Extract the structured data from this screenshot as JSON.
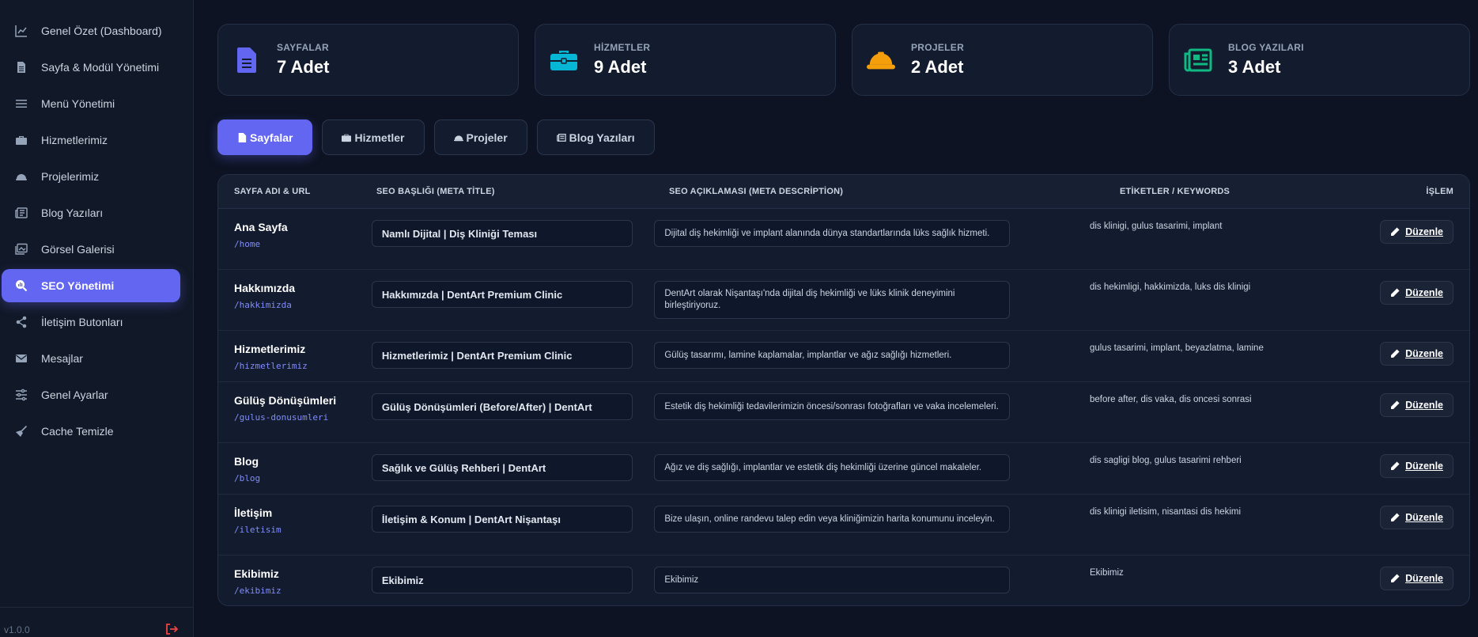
{
  "sidebar": {
    "items": [
      {
        "label": "Genel Özet (Dashboard)",
        "icon": "chart-line-icon"
      },
      {
        "label": "Sayfa & Modül Yönetimi",
        "icon": "file-icon"
      },
      {
        "label": "Menü Yönetimi",
        "icon": "bars-icon"
      },
      {
        "label": "Hizmetlerimiz",
        "icon": "briefcase-icon"
      },
      {
        "label": "Projelerimiz",
        "icon": "hardhat-icon"
      },
      {
        "label": "Blog Yazıları",
        "icon": "newspaper-icon"
      },
      {
        "label": "Görsel Galerisi",
        "icon": "images-icon"
      },
      {
        "label": "SEO Yönetimi",
        "icon": "search-chart-icon",
        "active": true
      },
      {
        "label": "İletişim Butonları",
        "icon": "share-icon"
      },
      {
        "label": "Mesajlar",
        "icon": "envelope-icon"
      },
      {
        "label": "Genel Ayarlar",
        "icon": "sliders-icon"
      },
      {
        "label": "Cache Temizle",
        "icon": "broom-icon"
      }
    ],
    "version": "v1.0.0"
  },
  "stats": [
    {
      "label": "SAYFALAR",
      "value": "7 Adet",
      "icon": "file-icon",
      "color": "#6366f1"
    },
    {
      "label": "HİZMETLER",
      "value": "9 Adet",
      "icon": "briefcase-icon",
      "color": "#06b6d4"
    },
    {
      "label": "PROJELER",
      "value": "2 Adet",
      "icon": "hardhat-icon",
      "color": "#f59e0b"
    },
    {
      "label": "BLOG YAZILARI",
      "value": "3 Adet",
      "icon": "newspaper-icon",
      "color": "#10b981"
    }
  ],
  "tabs": [
    {
      "label": "Sayfalar",
      "active": true
    },
    {
      "label": "Hizmetler"
    },
    {
      "label": "Projeler"
    },
    {
      "label": "Blog Yazıları"
    }
  ],
  "table": {
    "headers": [
      "SAYFA ADI & URL",
      "SEO BAŞLIĞI (META TİTLE)",
      "SEO AÇIKLAMASI (META DESCRİPTİON)",
      "ETİKETLER / KEYWORDS",
      "İŞLEM"
    ],
    "edit_label": "Düzenle",
    "rows": [
      {
        "name": "Ana Sayfa",
        "url": "/home",
        "title": "Namlı Dijital | Diş Kliniği Teması",
        "desc": "Dijital diş hekimliği ve implant alanında dünya standartlarında lüks sağlık hizmeti.",
        "keywords": "dis klinigi, gulus tasarimi, implant"
      },
      {
        "name": "Hakkımızda",
        "url": "/hakkimizda",
        "title": "Hakkımızda | DentArt Premium Clinic",
        "desc": "DentArt olarak Nişantaşı'nda dijital diş hekimliği ve lüks klinik deneyimini birleştiriyoruz.",
        "keywords": "dis hekimligi, hakkimizda, luks dis klinigi"
      },
      {
        "name": "Hizmetlerimiz",
        "url": "/hizmetlerimiz",
        "title": "Hizmetlerimiz | DentArt Premium Clinic",
        "desc": "Gülüş tasarımı, lamine kaplamalar, implantlar ve ağız sağlığı hizmetleri.",
        "keywords": "gulus tasarimi, implant, beyazlatma, lamine"
      },
      {
        "name": "Gülüş Dönüşümleri",
        "url": "/gulus-donusumleri",
        "title": "Gülüş Dönüşümleri (Before/After) | DentArt",
        "desc": "Estetik diş hekimliği tedavilerimizin öncesi/sonrası fotoğrafları ve vaka incelemeleri.",
        "keywords": "before after, dis vaka, dis oncesi sonrasi"
      },
      {
        "name": "Blog",
        "url": "/blog",
        "title": "Sağlık ve Gülüş Rehberi | DentArt",
        "desc": "Ağız ve diş sağlığı, implantlar ve estetik diş hekimliği üzerine güncel makaleler.",
        "keywords": "dis sagligi blog, gulus tasarimi rehberi"
      },
      {
        "name": "İletişim",
        "url": "/iletisim",
        "title": "İletişim & Konum | DentArt Nişantaşı",
        "desc": "Bize ulaşın, online randevu talep edin veya kliniğimizin harita konumunu inceleyin.",
        "keywords": "dis klinigi iletisim, nisantasi dis hekimi"
      },
      {
        "name": "Ekibimiz",
        "url": "/ekibimiz",
        "title": "Ekibimiz",
        "desc": "Ekibimiz",
        "keywords": "Ekibimiz"
      }
    ]
  },
  "colors": {
    "accent": "#6366f1",
    "logout": "#ef4444"
  }
}
